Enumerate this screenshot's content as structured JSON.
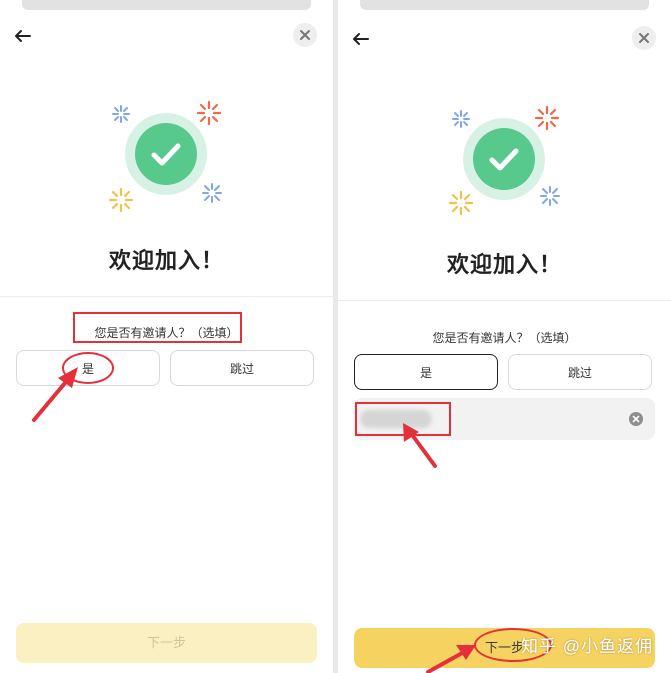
{
  "colors": {
    "accent": "#f6d360",
    "accent_disabled": "#fbf0c1",
    "success": "#57c98d",
    "annotation": "#e3303b"
  },
  "left": {
    "welcome": "欢迎加入！",
    "question": "您是否有邀请人？（选填）",
    "option_yes": "是",
    "option_skip": "跳过",
    "next": "下一步",
    "icons": [
      "back-arrow-icon",
      "close-icon",
      "checkmark-icon"
    ]
  },
  "right": {
    "welcome": "欢迎加入！",
    "question": "您是否有邀请人？（选填）",
    "option_yes": "是",
    "option_skip": "跳过",
    "invite_value": "",
    "next": "下一步",
    "icons": [
      "back-arrow-icon",
      "close-icon",
      "checkmark-icon",
      "clear-icon"
    ]
  },
  "watermark": "知乎 @小鱼返佣"
}
